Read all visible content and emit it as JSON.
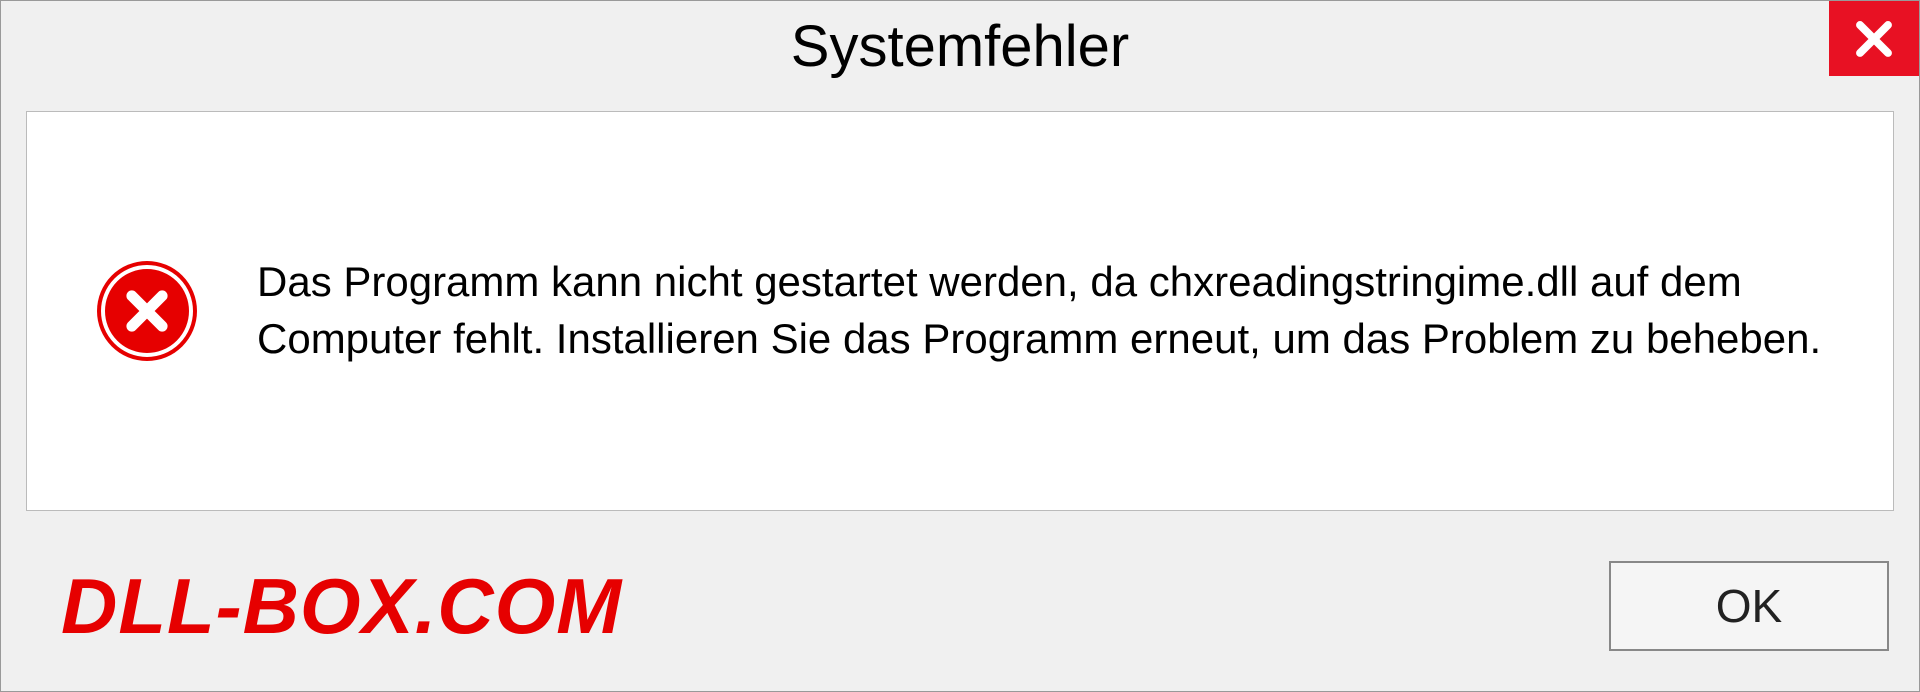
{
  "dialog": {
    "title": "Systemfehler",
    "message": "Das Programm kann nicht gestartet werden, da chxreadingstringime.dll auf dem Computer fehlt. Installieren Sie das Programm erneut, um das Problem zu beheben.",
    "ok_label": "OK"
  },
  "brand": {
    "text": "DLL-BOX.COM"
  },
  "colors": {
    "error_red": "#e60000",
    "close_red": "#e81123",
    "bg_gray": "#f0f0f0"
  }
}
